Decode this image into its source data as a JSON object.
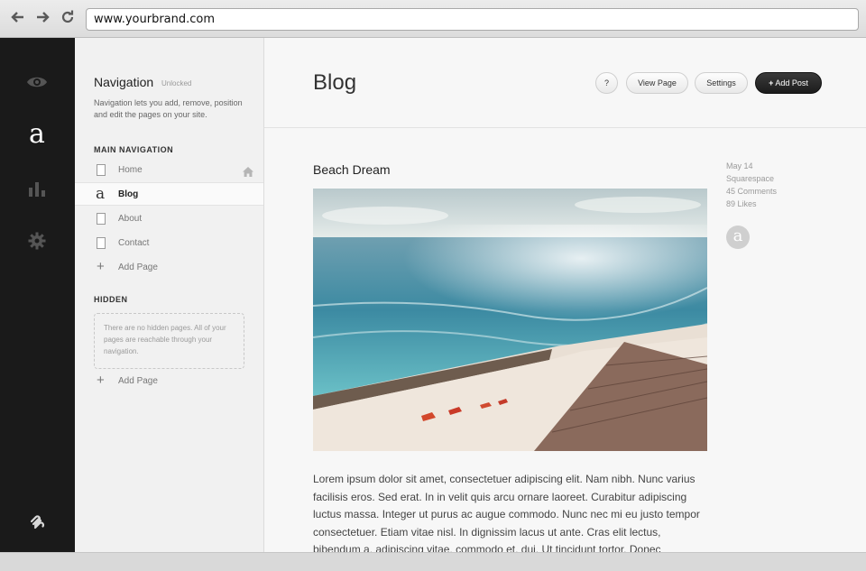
{
  "browser": {
    "url": "www.yourbrand.com"
  },
  "rail": {
    "icons": [
      "eye-icon",
      "squarespace-logo",
      "bar-chart-icon",
      "gear-icon",
      "squarespace-brand-icon"
    ],
    "logo_glyph": "a"
  },
  "navigation": {
    "title": "Navigation",
    "status": "Unlocked",
    "description": "Navigation lets you add, remove, position and edit the pages on your site.",
    "main_heading": "MAIN NAVIGATION",
    "items": [
      {
        "label": "Home",
        "icon": "page-icon",
        "is_home": true
      },
      {
        "label": "Blog",
        "icon": "blog-icon",
        "active": true
      },
      {
        "label": "About",
        "icon": "page-icon"
      },
      {
        "label": "Contact",
        "icon": "page-icon"
      },
      {
        "label": "Add Page",
        "icon": "plus-icon"
      }
    ],
    "hidden_heading": "HIDDEN",
    "hidden_message": "There are no hidden pages. All of your pages are reachable through your navigation.",
    "hidden_add_label": "Add Page"
  },
  "header": {
    "title": "Blog",
    "help_label": "?",
    "view_page_label": "View Page",
    "settings_label": "Settings",
    "add_post_label": "Add Post"
  },
  "post": {
    "title": "Beach Dream",
    "date": "May 14",
    "author": "Squarespace",
    "comments": "45 Comments",
    "likes": "89 Likes",
    "avatar_glyph": "a",
    "body": "Lorem ipsum dolor sit amet, consectetuer adipiscing elit. Nam nibh. Nunc varius facilisis eros. Sed erat. In in velit quis arcu ornare laoreet. Curabitur adipiscing luctus massa. Integer ut purus ac augue commodo. Nunc nec mi eu justo tempor consectetuer. Etiam vitae nisl. In dignissim lacus ut ante. Cras elit lectus, bibendum a, adipiscing vitae, commodo et, dui. Ut tincidunt tortor. Donec nonummy, enim in"
  },
  "colors": {
    "rail_bg": "#1a1a1a",
    "panel_bg": "#f1f1f1",
    "main_bg": "#f7f7f7",
    "dark_button": "#1f1f1f"
  }
}
